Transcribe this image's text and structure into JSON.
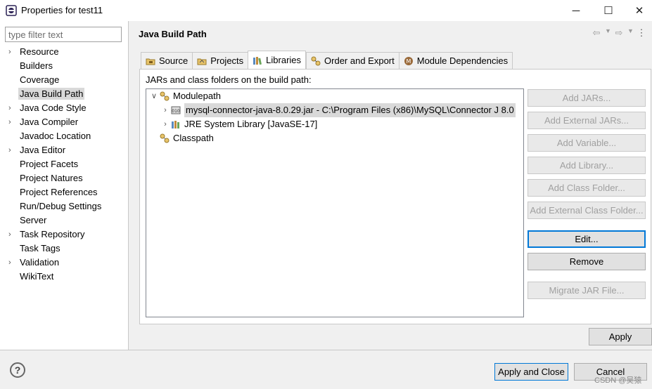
{
  "window": {
    "title": "Properties for test11",
    "controls": [
      "─",
      "☐",
      "✕"
    ]
  },
  "sidebar": {
    "filter_placeholder": "type filter text",
    "items": [
      {
        "label": "Resource",
        "expandable": true
      },
      {
        "label": "Builders",
        "expandable": false
      },
      {
        "label": "Coverage",
        "expandable": false
      },
      {
        "label": "Java Build Path",
        "expandable": false,
        "selected": true
      },
      {
        "label": "Java Code Style",
        "expandable": true
      },
      {
        "label": "Java Compiler",
        "expandable": true
      },
      {
        "label": "Javadoc Location",
        "expandable": false
      },
      {
        "label": "Java Editor",
        "expandable": true
      },
      {
        "label": "Project Facets",
        "expandable": false
      },
      {
        "label": "Project Natures",
        "expandable": false
      },
      {
        "label": "Project References",
        "expandable": false
      },
      {
        "label": "Run/Debug Settings",
        "expandable": false
      },
      {
        "label": "Server",
        "expandable": false
      },
      {
        "label": "Task Repository",
        "expandable": true
      },
      {
        "label": "Task Tags",
        "expandable": false
      },
      {
        "label": "Validation",
        "expandable": true
      },
      {
        "label": "WikiText",
        "expandable": false
      }
    ]
  },
  "page": {
    "title": "Java Build Path",
    "tabs": [
      {
        "label": "Source",
        "icon": "source-folder-icon"
      },
      {
        "label": "Projects",
        "icon": "projects-icon"
      },
      {
        "label": "Libraries",
        "icon": "libraries-icon",
        "active": true
      },
      {
        "label": "Order and Export",
        "icon": "order-export-icon"
      },
      {
        "label": "Module Dependencies",
        "icon": "module-dependencies-icon"
      }
    ],
    "description": "JARs and class folders on the build path:",
    "tree": {
      "modulepath": "Modulepath",
      "jar": "mysql-connector-java-8.0.29.jar - C:\\Program Files (x86)\\MySQL\\Connector J 8.0",
      "jre": "JRE System Library [JavaSE-17]",
      "classpath": "Classpath"
    },
    "buttons": {
      "add_jars": "Add JARs...",
      "add_external_jars": "Add External JARs...",
      "add_variable": "Add Variable...",
      "add_library": "Add Library...",
      "add_class_folder": "Add Class Folder...",
      "add_external_class_folder": "Add External Class Folder...",
      "edit": "Edit...",
      "remove": "Remove",
      "migrate_jar": "Migrate JAR File..."
    },
    "apply": "Apply"
  },
  "footer": {
    "help": "?",
    "apply_close": "Apply and Close",
    "cancel": "Cancel",
    "watermark": "CSDN @吴猿"
  }
}
